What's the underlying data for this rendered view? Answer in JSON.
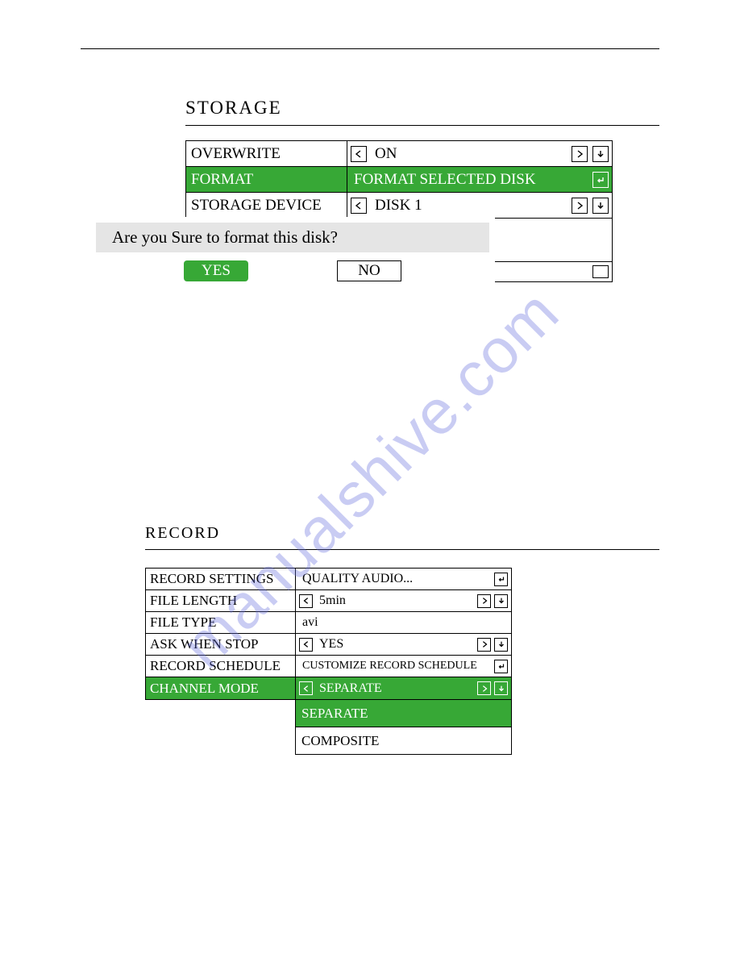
{
  "watermark": "manualshive.com",
  "storage": {
    "title": "STORAGE",
    "rows": {
      "overwrite": {
        "label": "OVERWRITE",
        "value": "ON"
      },
      "format": {
        "label": "FORMAT",
        "value": "FORMAT SELECTED DISK"
      },
      "device": {
        "label": "STORAGE DEVICE",
        "value": "DISK 1"
      }
    },
    "dialog": {
      "message": "Are you Sure to format this disk?",
      "yes": "YES",
      "no": "NO"
    }
  },
  "record": {
    "title": "RECORD",
    "rows": {
      "settings": {
        "label": "RECORD SETTINGS",
        "value": "QUALITY AUDIO..."
      },
      "length": {
        "label": "FILE LENGTH",
        "value": "5min"
      },
      "type": {
        "label": "FILE TYPE",
        "value": "avi"
      },
      "ask": {
        "label": "ASK WHEN STOP",
        "value": "YES"
      },
      "schedule": {
        "label": "RECORD SCHEDULE",
        "value": "CUSTOMIZE RECORD SCHEDULE"
      },
      "mode": {
        "label": "CHANNEL MODE",
        "value": "SEPARATE"
      }
    },
    "dropdown": {
      "option1": "SEPARATE",
      "option2": "COMPOSITE"
    }
  }
}
